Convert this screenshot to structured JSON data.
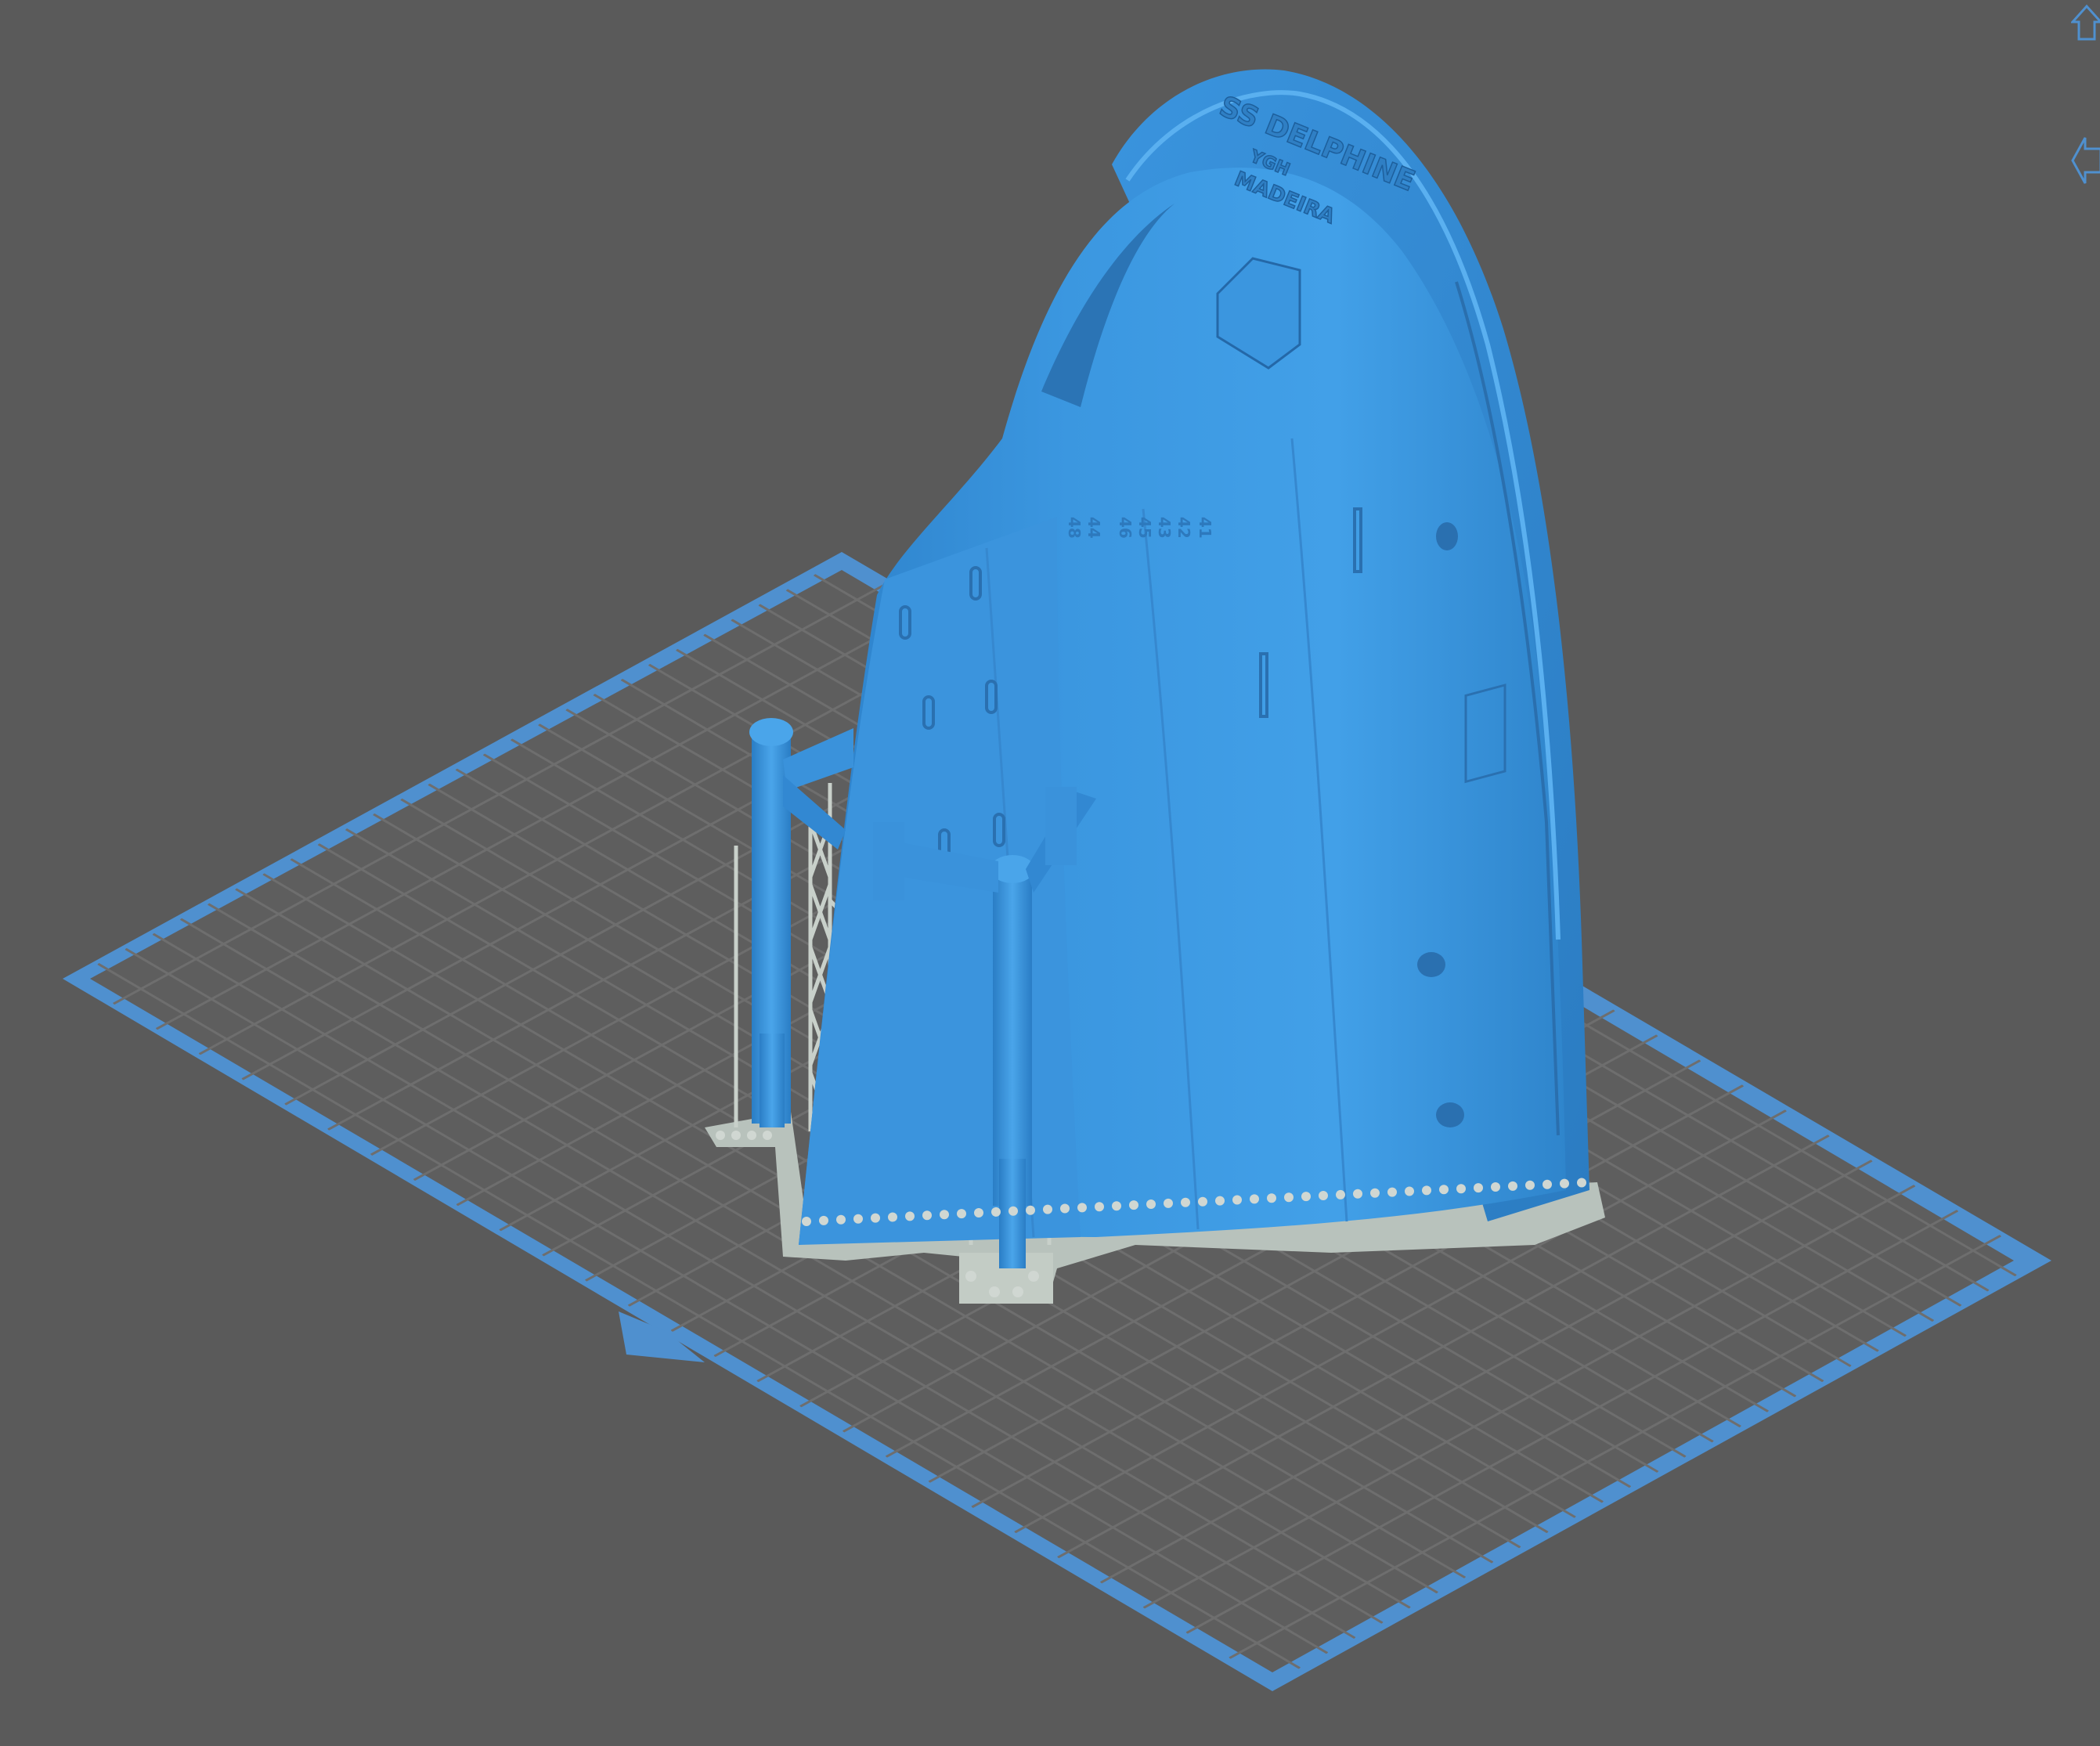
{
  "hull": {
    "name_line1": "SS DELPHINE",
    "name_line2": "YGH",
    "name_line3": "MADEIRA",
    "draft_marks": [
      "48",
      "44",
      "46",
      "45",
      "43",
      "42",
      "41"
    ]
  },
  "colors": {
    "background": "#5a5a5a",
    "plate_border": "#4f90cf",
    "grid_line": "#6b6b6b",
    "model": "#3e95dc",
    "support": "#c5cdc7"
  },
  "icons": {
    "top": "home-icon",
    "middle": "back-arrow-icon"
  }
}
